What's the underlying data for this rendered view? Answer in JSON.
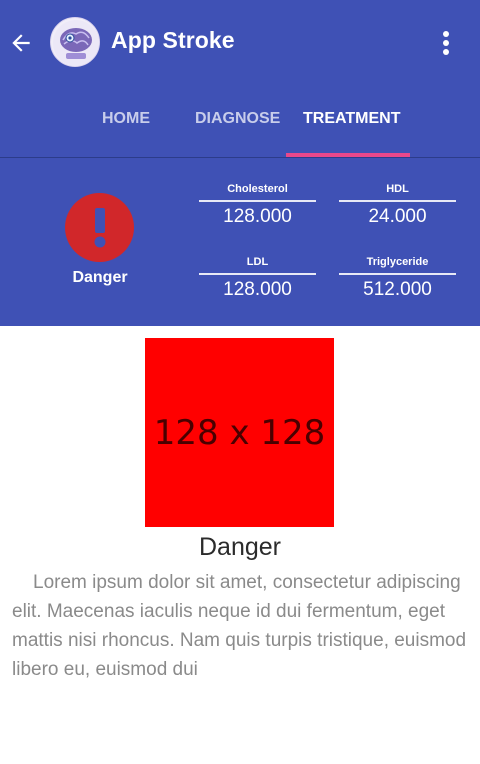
{
  "app": {
    "title": "App Stroke"
  },
  "tabs": [
    {
      "label": "HOME",
      "active": false
    },
    {
      "label": "DIAGNOSE",
      "active": false
    },
    {
      "label": "TREATMENT",
      "active": true
    }
  ],
  "status": {
    "icon": "alert-icon",
    "label": "Danger",
    "color": "#d1272a"
  },
  "metrics": {
    "cholesterol": {
      "label": "Cholesterol",
      "value": "128.000"
    },
    "hdl": {
      "label": "HDL",
      "value": "24.000"
    },
    "ldl": {
      "label": "LDL",
      "value": "128.000"
    },
    "triglyceride": {
      "label": "Triglyceride",
      "value": "512.000"
    }
  },
  "content": {
    "image_placeholder": "128 x 128",
    "title": "Danger",
    "body": "Lorem ipsum dolor sit amet, consectetur adipiscing elit. Maecenas iaculis neque id dui fermentum, eget mattis nisi rhoncus. Nam quis turpis tristique, euismod libero eu, euismod dui"
  },
  "colors": {
    "primary": "#3f51b5",
    "accent": "#e9488b",
    "danger": "#d1272a",
    "placeholder": "#ff0000"
  }
}
